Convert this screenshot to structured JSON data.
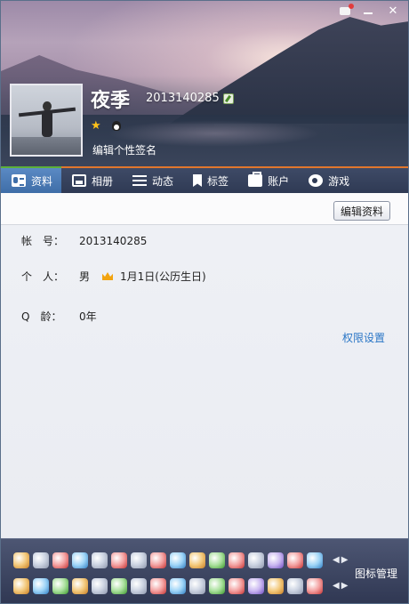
{
  "header": {
    "nickname": "夜季",
    "qq_number": "2013140285",
    "signature": "编辑个性签名"
  },
  "tabs": [
    {
      "label": "资料",
      "icon": "profile-card-icon",
      "active": true
    },
    {
      "label": "相册",
      "icon": "photo-album-icon",
      "active": false
    },
    {
      "label": "动态",
      "icon": "feed-list-icon",
      "active": false
    },
    {
      "label": "标签",
      "icon": "tag-icon",
      "active": false
    },
    {
      "label": "账户",
      "icon": "wallet-icon",
      "active": false
    },
    {
      "label": "游戏",
      "icon": "game-icon",
      "active": false
    }
  ],
  "profile": {
    "edit_button": "编辑资料",
    "rows": [
      {
        "label": "帐　号：",
        "value": "2013140285"
      },
      {
        "label": "个　人：",
        "gender": "男",
        "birthday": "1月1日(公历生日)"
      },
      {
        "label": "Q　龄：",
        "value": "0年"
      }
    ],
    "permission_link": "权限设置"
  },
  "dock": {
    "manage_label": "图标管理",
    "row1_icon_count": 16,
    "row2_icon_count": 16
  },
  "colors": {
    "tab_bar": "#2f3a54",
    "tab_active": "#3f6ea8",
    "accent_orange": "#e1772d",
    "link_blue": "#2a76c6",
    "dock": "#2f3752"
  }
}
